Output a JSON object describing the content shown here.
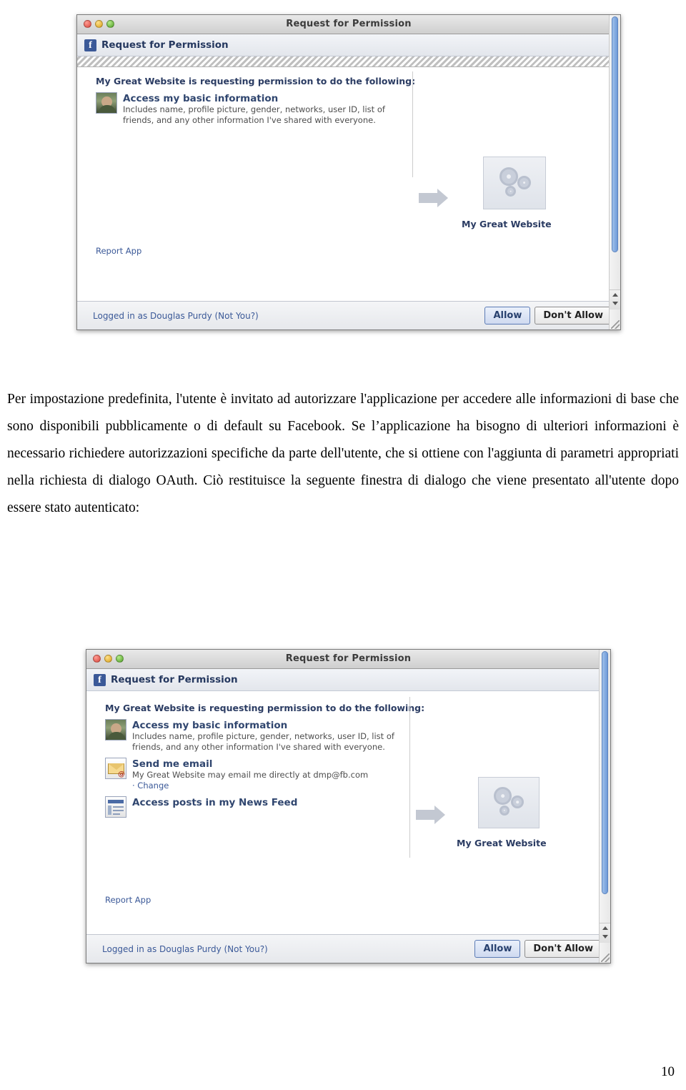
{
  "page": {
    "number": "10",
    "paragraph_html": "Per impostazione predefinita, l'utente è invitato ad autorizzare l'applicazione per accedere alle informazioni di base che sono disponibili pubblicamente o di default su Facebook. Se l&rsquo;applicazione ha bisogno di ulteriori informazioni è necessario richiedere autorizzazioni specifiche da parte dell'utente, che si ottiene con l'aggiunta di parametri appropriati nella richiesta di dialogo OAuth. Ciò restituisce la seguente finestra di dialogo che viene presentato all'utente dopo essere stato autenticato:"
  },
  "dialog": {
    "window_title": "Request for Permission",
    "fb_bar_title": "Request for Permission",
    "fb_logo_glyph": "f",
    "intro": "My Great Website is requesting permission to do the following:",
    "app_name": "My Great Website",
    "report_app": "Report App",
    "logged_in": "Logged in as Douglas Purdy (Not You?)",
    "allow_label": "Allow",
    "deny_label": "Don't Allow",
    "permissions_top": [
      {
        "icon": "profile-photo-icon",
        "title": "Access my basic information",
        "desc": "Includes name, profile picture, gender, networks, user ID, list of friends, and any other information I've shared with everyone."
      }
    ],
    "permissions_bottom": [
      {
        "icon": "profile-photo-icon",
        "title": "Access my basic information",
        "desc": "Includes name, profile picture, gender, networks, user ID, list of friends, and any other information I've shared with everyone."
      },
      {
        "icon": "envelope-icon",
        "title": "Send me email",
        "desc": "My Great Website may email me directly at dmp@fb.com",
        "change": "· Change"
      },
      {
        "icon": "news-feed-icon",
        "title": "Access posts in my News Feed",
        "desc": ""
      }
    ]
  },
  "colors": {
    "facebook_blue": "#3b5998",
    "heading_blue": "#30466f",
    "link_blue": "#3b5998",
    "scroll_thumb": "#6f9ad8"
  }
}
